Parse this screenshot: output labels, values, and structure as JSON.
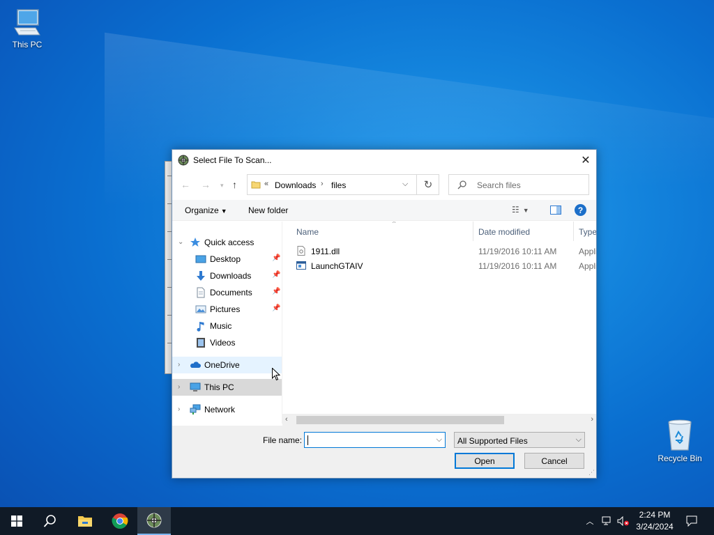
{
  "desktop": {
    "icons": [
      {
        "label": "This PC",
        "icon": "this-pc-icon"
      },
      {
        "label": "Recycle Bin",
        "icon": "recycle-bin-icon"
      }
    ]
  },
  "dialog": {
    "title": "Select File To Scan...",
    "address": {
      "prefix": "«",
      "segments": [
        "Downloads",
        "files"
      ]
    },
    "search_placeholder": "Search files",
    "toolbar": {
      "organize": "Organize",
      "new_folder": "New folder"
    },
    "nav": {
      "items": [
        {
          "label": "Quick access",
          "icon": "star-icon"
        },
        {
          "label": "Desktop",
          "icon": "desktop-icon",
          "pinned": true
        },
        {
          "label": "Downloads",
          "icon": "download-icon",
          "pinned": true
        },
        {
          "label": "Documents",
          "icon": "document-icon",
          "pinned": true
        },
        {
          "label": "Pictures",
          "icon": "picture-icon",
          "pinned": true
        },
        {
          "label": "Music",
          "icon": "music-icon"
        },
        {
          "label": "Videos",
          "icon": "video-icon"
        },
        {
          "label": "OneDrive",
          "icon": "cloud-icon"
        },
        {
          "label": "This PC",
          "icon": "computer-icon"
        },
        {
          "label": "Network",
          "icon": "network-icon"
        }
      ]
    },
    "columns": [
      "Name",
      "Date modified",
      "Type"
    ],
    "files": [
      {
        "name": "1911.dll",
        "date": "11/19/2016 10:11 AM",
        "type": "Appli",
        "icon": "dll-file-icon"
      },
      {
        "name": "LaunchGTAIV",
        "date": "11/19/2016 10:11 AM",
        "type": "Appli",
        "icon": "application-icon"
      }
    ],
    "file_name_label": "File name:",
    "file_name_value": "",
    "filter": "All Supported Files",
    "open_label": "Open",
    "cancel_label": "Cancel"
  },
  "taskbar": {
    "time": "2:24 PM",
    "date": "3/24/2024"
  }
}
